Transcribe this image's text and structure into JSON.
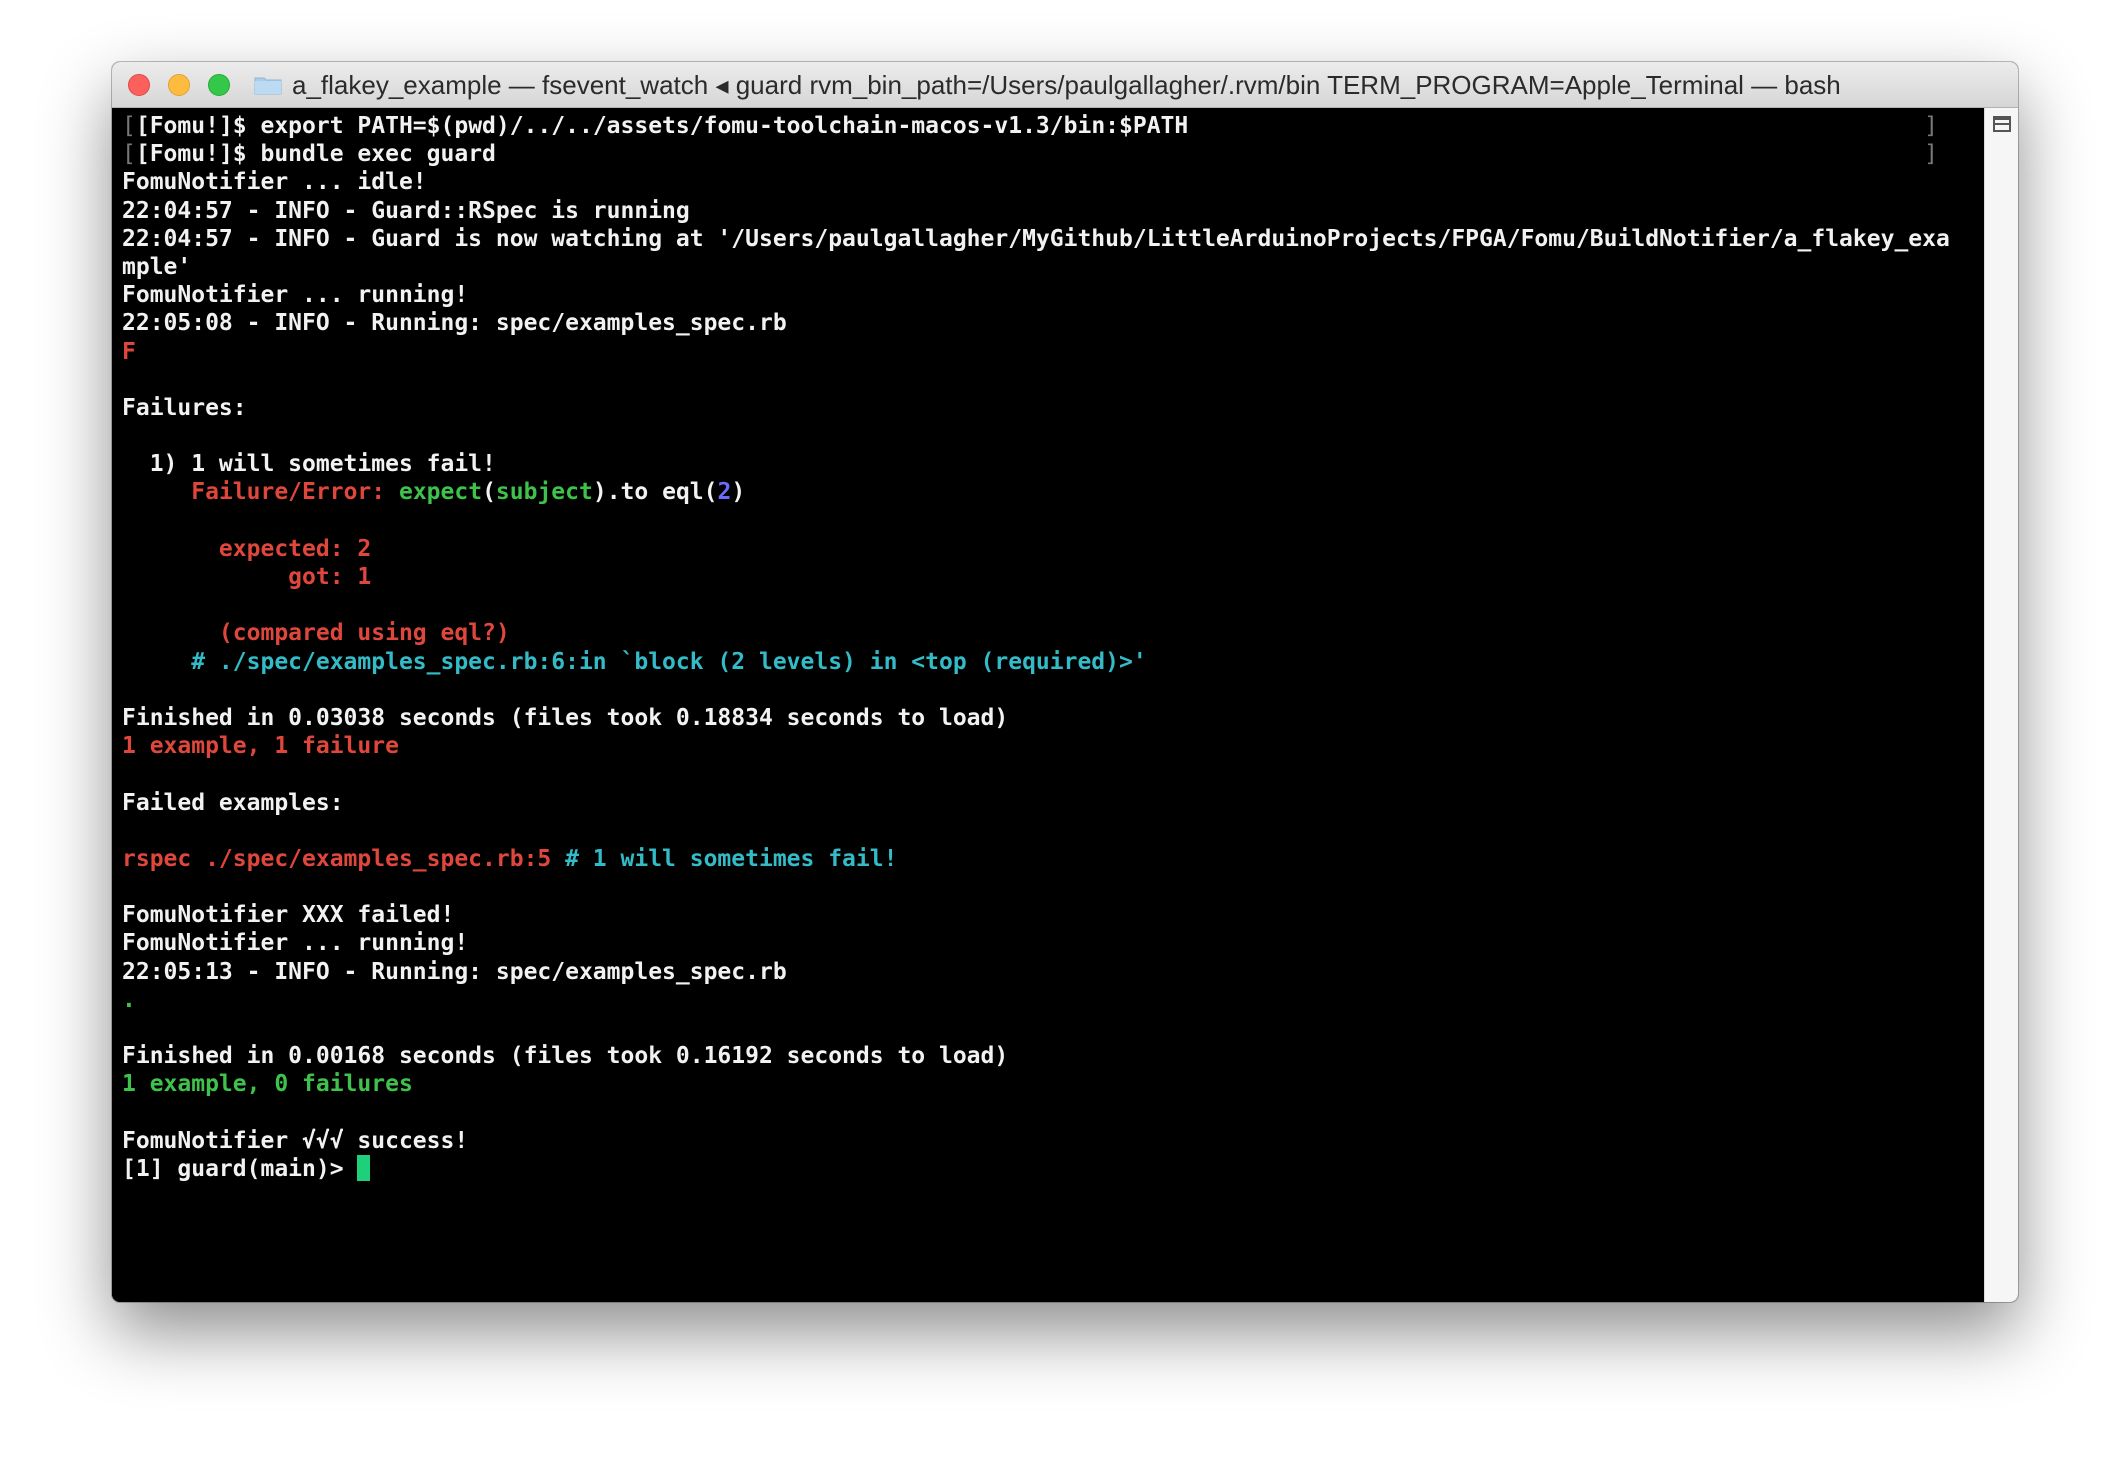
{
  "window": {
    "title": "a_flakey_example — fsevent_watch ◂ guard rvm_bin_path=/Users/paulgallagher/.rvm/bin TERM_PROGRAM=Apple_Terminal — bash"
  },
  "terminal": {
    "prompt1": "[Fomu!]$ export PATH=$(pwd)/../../assets/fomu-toolchain-macos-v1.3/bin:$PATH",
    "prompt2": "[Fomu!]$ bundle exec guard",
    "l_idle": "FomuNotifier ... idle!",
    "l_info1": "22:04:57 - INFO - Guard::RSpec is running",
    "l_info2a": "22:04:57 - INFO - Guard is now watching at '/Users/paulgallagher/MyGithub/LittleArduinoProjects/FPGA/Fomu/BuildNotifier/a_flakey_exa",
    "l_info2b": "mple'",
    "l_running1": "FomuNotifier ... running!",
    "l_run1": "22:05:08 - INFO - Running: spec/examples_spec.rb",
    "l_F": "F",
    "l_failures": "Failures:",
    "l_fail1": "  1) 1 will sometimes fail!",
    "fe_prefix": "     ",
    "fe_label": "Failure/Error: ",
    "fe_expect": "expect",
    "fe_paren1": "(",
    "fe_subject": "subject",
    "fe_mid": ").to eql(",
    "fe_num": "2",
    "fe_end": ")",
    "l_expected": "       expected: 2",
    "l_got": "            got: 1",
    "l_compared": "       (compared using eql?)",
    "l_trace": "     # ./spec/examples_spec.rb:6:in `block (2 levels) in <top (required)>'",
    "l_finished1": "Finished in 0.03038 seconds (files took 0.18834 seconds to load)",
    "l_summary1": "1 example, 1 failure",
    "l_failed_examples": "Failed examples:",
    "l_rspec": "rspec ./spec/examples_spec.rb:5",
    "l_rspec_comment": " # 1 will sometimes fail!",
    "l_xxx": "FomuNotifier XXX failed!",
    "l_running2": "FomuNotifier ... running!",
    "l_run2": "22:05:13 - INFO - Running: spec/examples_spec.rb",
    "l_dot": ".",
    "l_finished2": "Finished in 0.00168 seconds (files took 0.16192 seconds to load)",
    "l_summary2": "1 example, 0 failures",
    "l_success": "FomuNotifier √√√ success!",
    "l_prompt_guard": "[1] guard(main)> "
  },
  "colors": {
    "red": "#e0473c",
    "green": "#3fc24b",
    "cyan": "#33bbc8",
    "blue": "#6d6bff",
    "cursor": "#1fd07a"
  }
}
